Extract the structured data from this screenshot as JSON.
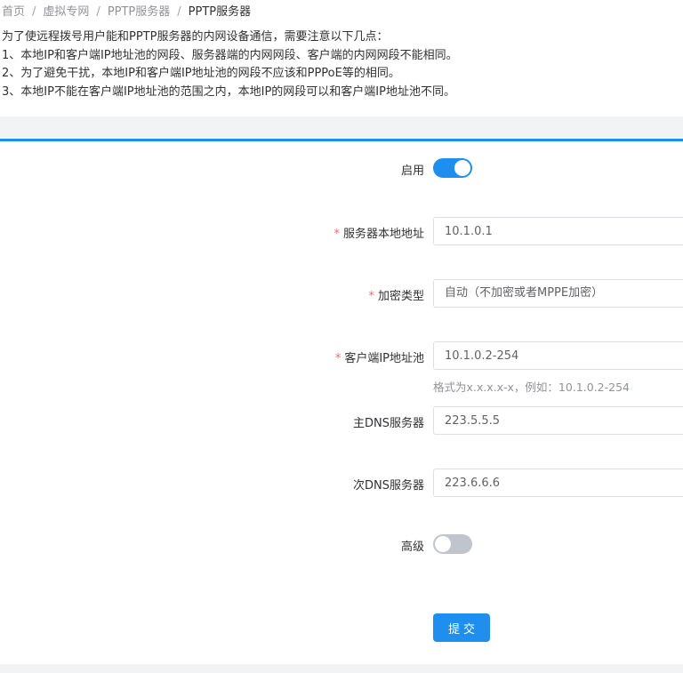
{
  "breadcrumb": {
    "items": [
      "首页",
      "虚拟专网",
      "PPTP服务器",
      "PPTP服务器"
    ],
    "separator": "/"
  },
  "notice": {
    "lines": [
      "为了使远程拨号用户能和PPTP服务器的内网设备通信，需要注意以下几点：",
      "1、本地IP和客户端IP地址池的网段、服务器端的内网网段、客户端的内网网段不能相同。",
      "2、为了避免干扰，本地IP和客户端IP地址池的网段不应该和PPPoE等的相同。",
      "3、本地IP不能在客户端IP地址池的范围之内，本地IP的网段可以和客户端IP地址池不同。"
    ]
  },
  "form": {
    "enable": {
      "label": "启用",
      "checked": true
    },
    "server_local_address": {
      "required_mark": "*",
      "label": "服务器本地地址",
      "value": "10.1.0.1"
    },
    "encryption_type": {
      "required_mark": "*",
      "label": "加密类型",
      "value": "自动（不加密或者MPPE加密）"
    },
    "client_ip_pool": {
      "required_mark": "*",
      "label": "客户端IP地址池",
      "value": "10.1.0.2-254",
      "hint": "格式为x.x.x.x-x，例如：10.1.0.2-254"
    },
    "primary_dns": {
      "label": "主DNS服务器",
      "value": "223.5.5.5"
    },
    "secondary_dns": {
      "label": "次DNS服务器",
      "value": "223.6.6.6"
    },
    "advanced": {
      "label": "高级",
      "checked": false
    },
    "submit_label": "提交"
  },
  "colors": {
    "primary": "#1f8fef",
    "required": "#f56c6c",
    "switch_off": "#c0c4cc"
  }
}
